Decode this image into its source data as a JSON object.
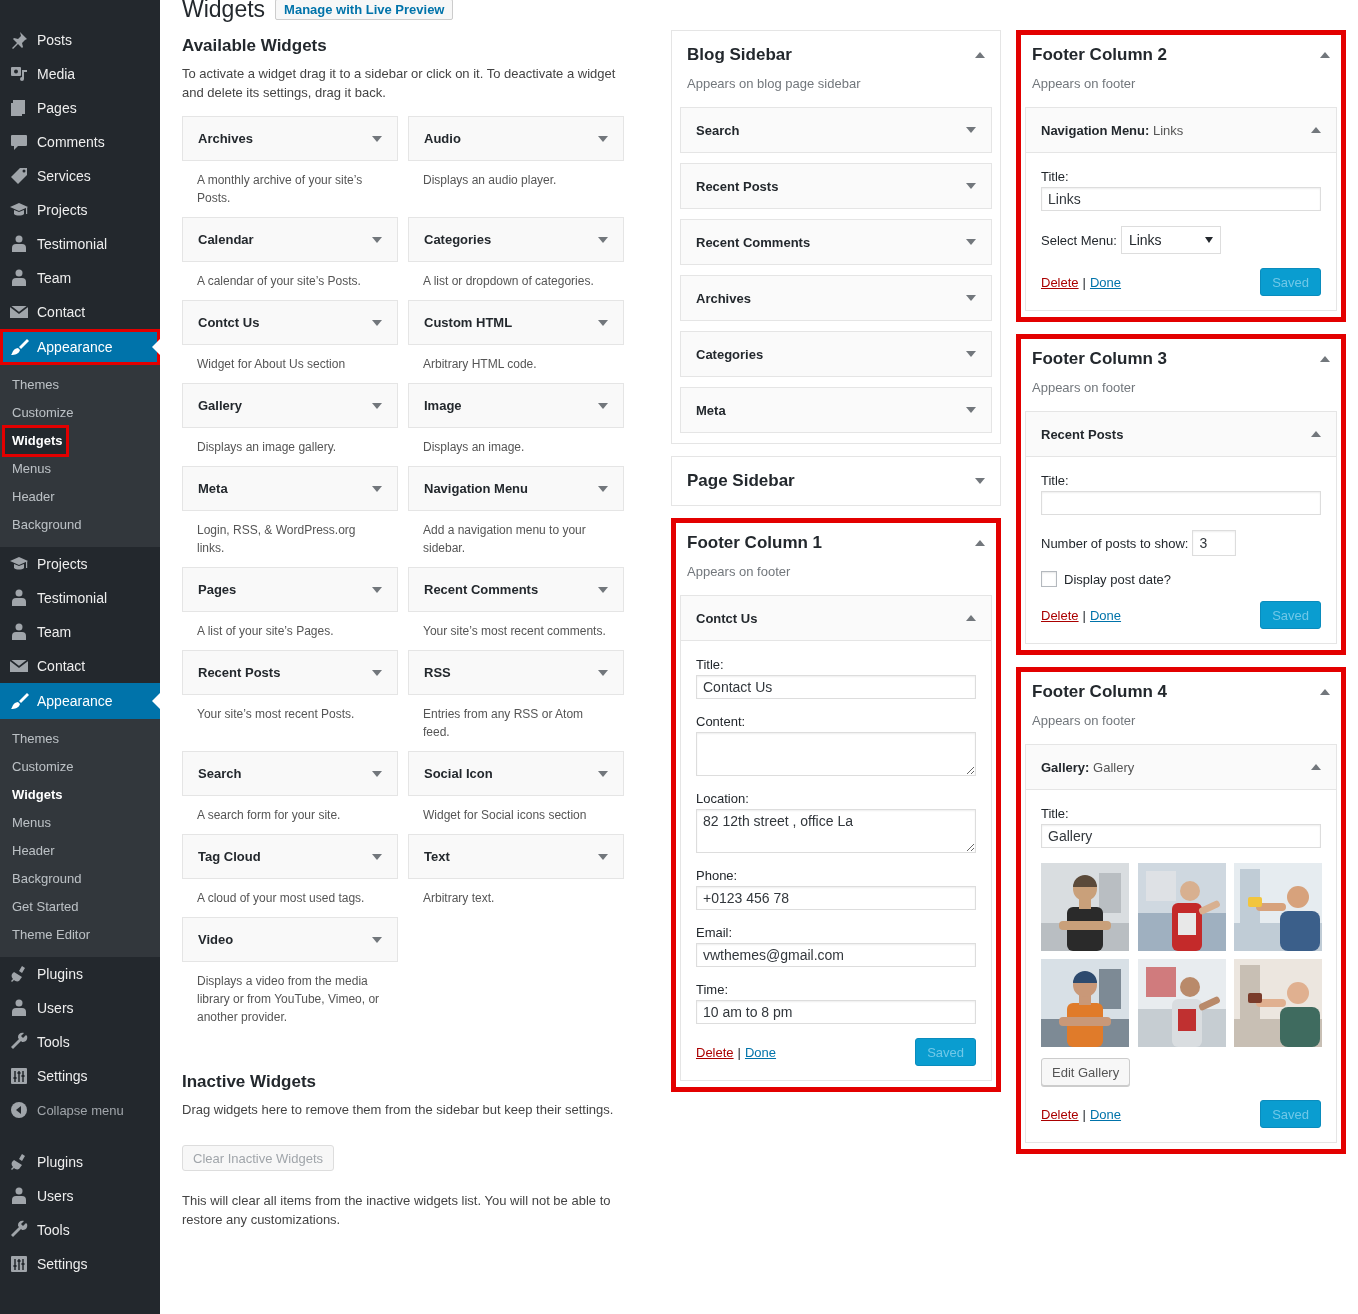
{
  "page": {
    "title": "Widgets",
    "action": "Manage with Live Preview"
  },
  "admin_menu": [
    {
      "label": "Posts",
      "kind": "item",
      "selected": false,
      "highlighted": false
    },
    {
      "label": "Media",
      "kind": "item",
      "selected": false,
      "highlighted": false
    },
    {
      "label": "Pages",
      "kind": "item",
      "selected": false,
      "highlighted": false
    },
    {
      "label": "Comments",
      "kind": "item",
      "selected": false,
      "highlighted": false
    },
    {
      "label": "Services",
      "kind": "item",
      "selected": false,
      "highlighted": false
    },
    {
      "label": "Projects",
      "kind": "item",
      "selected": false,
      "highlighted": false
    },
    {
      "label": "Testimonial",
      "kind": "item",
      "selected": false,
      "highlighted": false
    },
    {
      "label": "Team",
      "kind": "item",
      "selected": false,
      "highlighted": false
    },
    {
      "label": "Contact",
      "kind": "item",
      "selected": false,
      "highlighted": false
    },
    {
      "label": "Appearance",
      "kind": "item",
      "selected": true,
      "highlighted": true,
      "children": [
        {
          "label": "Themes",
          "selected": false,
          "highlighted": false
        },
        {
          "label": "Customize",
          "selected": false,
          "highlighted": false
        },
        {
          "label": "Widgets",
          "selected": true,
          "highlighted": true
        },
        {
          "label": "Menus",
          "selected": false,
          "highlighted": false
        },
        {
          "label": "Header",
          "selected": false,
          "highlighted": false
        },
        {
          "label": "Background",
          "selected": false,
          "highlighted": false
        }
      ]
    },
    {
      "label": "Projects",
      "kind": "item",
      "selected": false,
      "highlighted": false
    },
    {
      "label": "Testimonial",
      "kind": "item",
      "selected": false,
      "highlighted": false
    },
    {
      "label": "Team",
      "kind": "item",
      "selected": false,
      "highlighted": false
    },
    {
      "label": "Contact",
      "kind": "item",
      "selected": false,
      "highlighted": false
    },
    {
      "label": "Appearance",
      "kind": "item",
      "selected": true,
      "highlighted": false,
      "children": [
        {
          "label": "Themes",
          "selected": false,
          "highlighted": false
        },
        {
          "label": "Customize",
          "selected": false,
          "highlighted": false
        },
        {
          "label": "Widgets",
          "selected": true,
          "highlighted": false
        },
        {
          "label": "Menus",
          "selected": false,
          "highlighted": false
        },
        {
          "label": "Header",
          "selected": false,
          "highlighted": false
        },
        {
          "label": "Background",
          "selected": false,
          "highlighted": false
        },
        {
          "label": "Get Started",
          "selected": false,
          "highlighted": false
        },
        {
          "label": "Theme Editor",
          "selected": false,
          "highlighted": false
        }
      ]
    },
    {
      "label": "Plugins",
      "kind": "item",
      "selected": false,
      "highlighted": false
    },
    {
      "label": "Users",
      "kind": "item",
      "selected": false,
      "highlighted": false
    },
    {
      "label": "Tools",
      "kind": "item",
      "selected": false,
      "highlighted": false
    },
    {
      "label": "Settings",
      "kind": "item",
      "selected": false,
      "highlighted": false
    },
    {
      "label": "Collapse menu",
      "kind": "collapse",
      "selected": false,
      "highlighted": false
    },
    {
      "label": "Plugins",
      "kind": "item",
      "selected": false,
      "highlighted": false
    },
    {
      "label": "Users",
      "kind": "item",
      "selected": false,
      "highlighted": false
    },
    {
      "label": "Tools",
      "kind": "item",
      "selected": false,
      "highlighted": false
    },
    {
      "label": "Settings",
      "kind": "item",
      "selected": false,
      "highlighted": false
    }
  ],
  "available": {
    "title": "Available Widgets",
    "description": "To activate a widget drag it to a sidebar or click on it. To deactivate a widget and delete its settings, drag it back.",
    "widgets": [
      {
        "title": "Archives",
        "description": "A monthly archive of your site’s Posts."
      },
      {
        "title": "Audio",
        "description": "Displays an audio player."
      },
      {
        "title": "Calendar",
        "description": "A calendar of your site’s Posts."
      },
      {
        "title": "Categories",
        "description": "A list or dropdown of categories."
      },
      {
        "title": "Contct Us",
        "description": "Widget for About Us section"
      },
      {
        "title": "Custom HTML",
        "description": "Arbitrary HTML code."
      },
      {
        "title": "Gallery",
        "description": "Displays an image gallery."
      },
      {
        "title": "Image",
        "description": "Displays an image."
      },
      {
        "title": "Meta",
        "description": "Login, RSS, & WordPress.org links."
      },
      {
        "title": "Navigation Menu",
        "description": "Add a navigation menu to your sidebar."
      },
      {
        "title": "Pages",
        "description": "A list of your site’s Pages."
      },
      {
        "title": "Recent Comments",
        "description": "Your site’s most recent comments."
      },
      {
        "title": "Recent Posts",
        "description": "Your site’s most recent Posts."
      },
      {
        "title": "RSS",
        "description": "Entries from any RSS or Atom feed."
      },
      {
        "title": "Search",
        "description": "A search form for your site."
      },
      {
        "title": "Social Icon",
        "description": "Widget for Social icons section"
      },
      {
        "title": "Tag Cloud",
        "description": "A cloud of your most used tags."
      },
      {
        "title": "Text",
        "description": "Arbitrary text."
      },
      {
        "title": "Video",
        "description": "Displays a video from the media library or from YouTube, Vimeo, or another provider."
      }
    ]
  },
  "inactive": {
    "title": "Inactive Widgets",
    "description": "Drag widgets here to remove them from the sidebar but keep their settings.",
    "button": {
      "label": "Clear Inactive Widgets",
      "disabled": true
    },
    "note": "This will clear all items from the inactive widgets list. You will not be able to restore any customizations."
  },
  "columns": [
    [
      {
        "title": "Blog Sidebar",
        "description": "Appears on blog page sidebar",
        "expanded": true,
        "highlighted": false,
        "widgets": [
          {
            "title": "Search",
            "expanded": false
          },
          {
            "title": "Recent Posts",
            "expanded": false
          },
          {
            "title": "Recent Comments",
            "expanded": false
          },
          {
            "title": "Archives",
            "expanded": false
          },
          {
            "title": "Categories",
            "expanded": false
          },
          {
            "title": "Meta",
            "expanded": false
          }
        ]
      },
      {
        "title": "Page Sidebar",
        "expanded": false,
        "highlighted": false
      },
      {
        "title": "Footer Column 1",
        "description": "Appears on footer",
        "expanded": true,
        "highlighted": true,
        "widgets": [
          {
            "title": "Contct Us",
            "expanded": true,
            "fields": [
              {
                "kind": "text",
                "label": "Title:",
                "value": "Contact Us"
              },
              {
                "kind": "textarea",
                "label": "Content:"
              },
              {
                "kind": "textarea",
                "label": "Location:",
                "value": "82 12th street , office La"
              },
              {
                "kind": "text",
                "label": "Phone:",
                "value": "+0123 456 78"
              },
              {
                "kind": "text",
                "label": "Email:",
                "value": "vwthemes@gmail.com"
              },
              {
                "kind": "text",
                "label": "Time:",
                "value": "10 am to 8 pm"
              }
            ],
            "actions": {
              "delete": "Delete",
              "separator": "|",
              "done": "Done",
              "save": "Saved",
              "save_disabled": true
            }
          }
        ]
      }
    ],
    [
      {
        "title": "Footer Column 2",
        "description": "Appears on footer",
        "expanded": true,
        "highlighted": true,
        "widgets": [
          {
            "title": "**Navigation Menu:** Links",
            "expanded": true,
            "fields": [
              {
                "kind": "text",
                "label": "Title:",
                "value": "Links"
              },
              {
                "kind": "select",
                "label": "Select Menu:",
                "value": "Links"
              }
            ],
            "actions": {
              "delete": "Delete",
              "separator": "|",
              "done": "Done",
              "save": "Saved",
              "save_disabled": true
            }
          }
        ]
      },
      {
        "title": "Footer Column 3",
        "description": "Appears on footer",
        "expanded": true,
        "highlighted": true,
        "widgets": [
          {
            "title": "Recent Posts",
            "expanded": true,
            "fields": [
              {
                "kind": "text",
                "label": "Title:"
              },
              {
                "kind": "number",
                "label": "Number of posts to show:",
                "value": "3"
              },
              {
                "kind": "checkbox",
                "label": "Display post date?",
                "checked": false
              }
            ],
            "actions": {
              "delete": "Delete",
              "separator": "|",
              "done": "Done",
              "save": "Saved",
              "save_disabled": true
            }
          }
        ]
      },
      {
        "title": "Footer Column 4",
        "description": "Appears on footer",
        "expanded": true,
        "highlighted": true,
        "widgets": [
          {
            "title": "**Gallery:** Gallery",
            "expanded": true,
            "fields": [
              {
                "kind": "text",
                "label": "Title:",
                "value": "Gallery"
              },
              {
                "kind": "gallery"
              },
              {
                "kind": "button",
                "label": "Edit Gallery"
              }
            ],
            "actions": {
              "delete": "Delete",
              "separator": "|",
              "done": "Done",
              "save": "Saved",
              "save_disabled": true
            }
          }
        ]
      }
    ]
  ]
}
